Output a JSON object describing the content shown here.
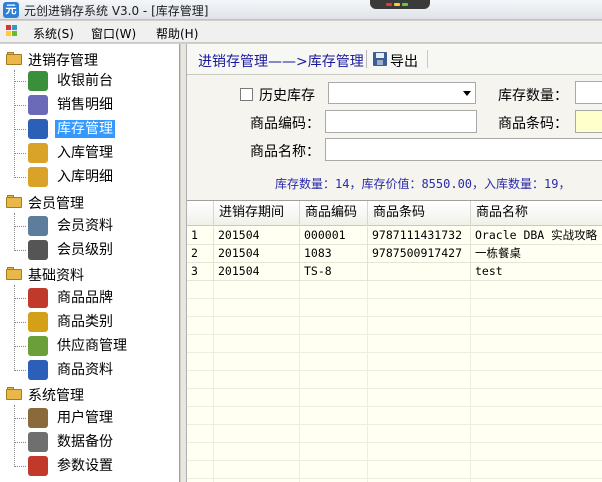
{
  "window": {
    "title": "元创进销存系统 V3.0  - [库存管理]",
    "app_icon_glyph": "元"
  },
  "menu": {
    "items": [
      {
        "label": "系统(S)"
      },
      {
        "label": "窗口(W)"
      },
      {
        "label": "帮助(H)"
      }
    ]
  },
  "sidebar": {
    "groups": [
      {
        "label": "进销存管理",
        "items": [
          {
            "label": "收银前台",
            "icon": "cart-icon",
            "color": "#3a8f3a"
          },
          {
            "label": "销售明细",
            "icon": "checklist-icon",
            "color": "#6a6ab8"
          },
          {
            "label": "库存管理",
            "icon": "box-b-icon",
            "color": "#2b5fb8"
          },
          {
            "label": "入库管理",
            "icon": "package-in-icon",
            "color": "#d9a229"
          },
          {
            "label": "入库明细",
            "icon": "package-detail-icon",
            "color": "#d9a229"
          }
        ]
      },
      {
        "label": "会员管理",
        "items": [
          {
            "label": "会员资料",
            "icon": "member-card-icon",
            "color": "#5c7d9c"
          },
          {
            "label": "会员级别",
            "icon": "member-level-icon",
            "color": "#555555"
          }
        ]
      },
      {
        "label": "基础资料",
        "items": [
          {
            "label": "商品品牌",
            "icon": "brand-icon",
            "color": "#c0392b"
          },
          {
            "label": "商品类别",
            "icon": "pencils-icon",
            "color": "#d4a017"
          },
          {
            "label": "供应商管理",
            "icon": "supplier-icon",
            "color": "#6a9f3a"
          },
          {
            "label": "商品资料",
            "icon": "goods-icon",
            "color": "#2b5fb8"
          }
        ]
      },
      {
        "label": "系统管理",
        "items": [
          {
            "label": "用户管理",
            "icon": "user-icon",
            "color": "#8a6a3a"
          },
          {
            "label": "数据备份",
            "icon": "database-icon",
            "color": "#6f6f6f"
          },
          {
            "label": "参数设置",
            "icon": "letter-a-icon",
            "color": "#c0392b"
          }
        ]
      }
    ],
    "selected": "库存管理"
  },
  "toolbar": {
    "breadcrumb": "进销存管理——>库存管理",
    "export_label": "导出"
  },
  "filters": {
    "history_label": "历史库存",
    "history_checked": false,
    "history_select_value": "",
    "stock_qty_label": "库存数量：",
    "stock_qty_value": "",
    "code_label": "商品编码：",
    "code_value": "",
    "barcode_label": "商品条码：",
    "barcode_value": "",
    "name_label": "商品名称：",
    "name_value": "",
    "summary": "库存数量：14，库存价值：8550.00，入库数量：19，"
  },
  "grid": {
    "columns": [
      "",
      "进销存期间",
      "商品编码",
      "商品条码",
      "商品名称"
    ],
    "rows": [
      [
        "1",
        "201504",
        "000001",
        "9787111431732",
        "Oracle DBA 实战攻略"
      ],
      [
        "2",
        "201504",
        "1083",
        "9787500917427",
        "一栋餐桌"
      ],
      [
        "3",
        "201504",
        "TS-8",
        "",
        "test"
      ]
    ]
  },
  "colors": {
    "accent_selected": "#3399ff",
    "breadcrumb_text": "#1a1a9e",
    "summary_text": "#2a2aaa",
    "grid_background": "#fffff2",
    "barcode_field_bg": "#ffffcc"
  }
}
